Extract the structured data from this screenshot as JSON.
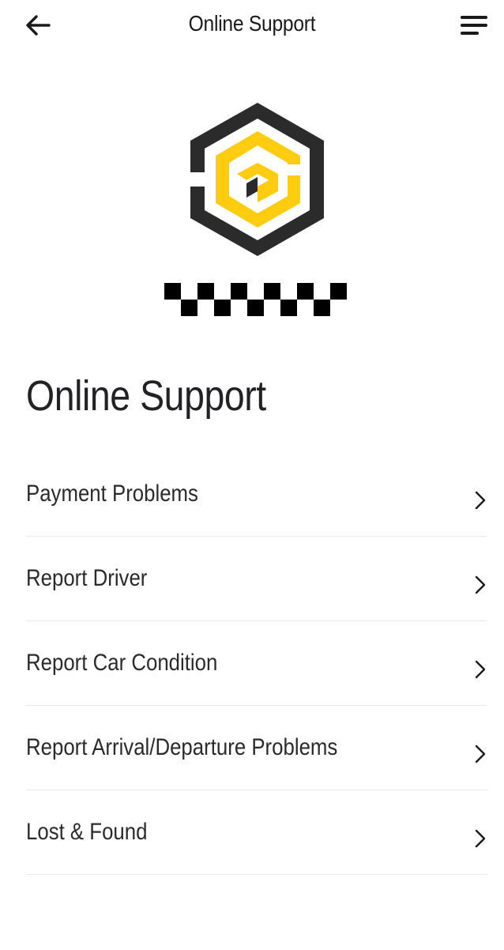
{
  "header": {
    "title": "Online Support",
    "back_icon": "arrow-left-icon",
    "menu_icon": "menu-lines-icon"
  },
  "brand": {
    "primary_color": "#2b2b2b",
    "accent_color": "#ffcc0f"
  },
  "main": {
    "title": "Online Support",
    "items": [
      {
        "label": "Payment Problems",
        "icon": "chevron-right-icon"
      },
      {
        "label": "Report Driver",
        "icon": "chevron-right-icon"
      },
      {
        "label": "Report Car Condition",
        "icon": "chevron-right-icon"
      },
      {
        "label": "Report Arrival/Departure Problems",
        "icon": "chevron-right-icon"
      },
      {
        "label": "Lost & Found",
        "icon": "chevron-right-icon"
      }
    ]
  }
}
